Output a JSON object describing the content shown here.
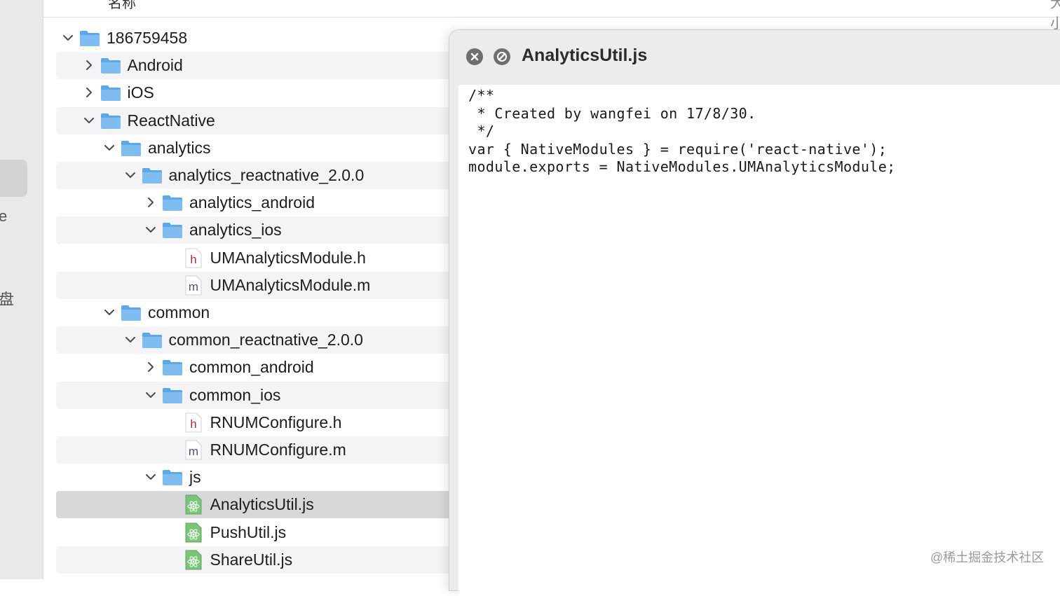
{
  "header": {
    "name_col": "名称",
    "size_col": "大小"
  },
  "sidebar": {
    "fragments": [
      "e",
      "盘"
    ]
  },
  "tree": [
    {
      "label": "186759458",
      "kind": "folder",
      "depth": 0,
      "expanded": true
    },
    {
      "label": "Android",
      "kind": "folder",
      "depth": 1,
      "expanded": false
    },
    {
      "label": "iOS",
      "kind": "folder",
      "depth": 1,
      "expanded": false
    },
    {
      "label": "ReactNative",
      "kind": "folder",
      "depth": 1,
      "expanded": true
    },
    {
      "label": "analytics",
      "kind": "folder",
      "depth": 2,
      "expanded": true
    },
    {
      "label": "analytics_reactnative_2.0.0",
      "kind": "folder",
      "depth": 3,
      "expanded": true
    },
    {
      "label": "analytics_android",
      "kind": "folder",
      "depth": 4,
      "expanded": false
    },
    {
      "label": "analytics_ios",
      "kind": "folder",
      "depth": 4,
      "expanded": true
    },
    {
      "label": "UMAnalyticsModule.h",
      "kind": "file-h",
      "depth": 5,
      "badge": "h"
    },
    {
      "label": "UMAnalyticsModule.m",
      "kind": "file-m",
      "depth": 5,
      "badge": "m"
    },
    {
      "label": "common",
      "kind": "folder",
      "depth": 2,
      "expanded": true
    },
    {
      "label": "common_reactnative_2.0.0",
      "kind": "folder",
      "depth": 3,
      "expanded": true
    },
    {
      "label": "common_android",
      "kind": "folder",
      "depth": 4,
      "expanded": false
    },
    {
      "label": "common_ios",
      "kind": "folder",
      "depth": 4,
      "expanded": true
    },
    {
      "label": "RNUMConfigure.h",
      "kind": "file-h",
      "depth": 5,
      "badge": "h"
    },
    {
      "label": "RNUMConfigure.m",
      "kind": "file-m",
      "depth": 5,
      "badge": "m"
    },
    {
      "label": "js",
      "kind": "folder",
      "depth": 4,
      "expanded": true
    },
    {
      "label": "AnalyticsUtil.js",
      "kind": "file-js",
      "depth": 5,
      "selected": true
    },
    {
      "label": "PushUtil.js",
      "kind": "file-js",
      "depth": 5
    },
    {
      "label": "ShareUtil.js",
      "kind": "file-js",
      "depth": 5
    }
  ],
  "preview": {
    "title": "AnalyticsUtil.js",
    "code_lines": [
      "/**",
      " * Created by wangfei on 17/8/30.",
      " */",
      "var { NativeModules } = require('react-native');",
      "module.exports = NativeModules.UMAnalyticsModule;"
    ]
  },
  "watermark": "@稀土掘金技术社区",
  "colors": {
    "folder": "#5fa8e8",
    "selected_row": "#d8d8dc",
    "alt_row": "#f4f4f6"
  }
}
